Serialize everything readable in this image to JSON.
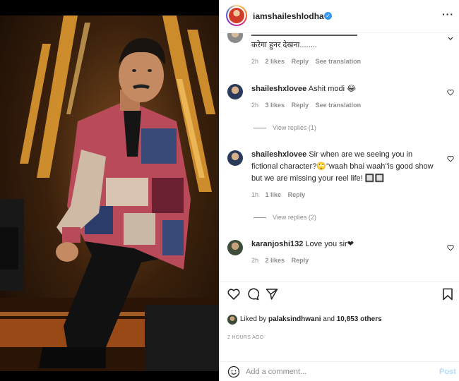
{
  "header": {
    "username": "iamshaileshlodha",
    "verified_icon": "verified-badge-icon",
    "more_icon": "more-options-icon"
  },
  "comments": [
    {
      "text": "करेगा हुनर देखना........",
      "time": "2h",
      "likes": "2 likes",
      "reply": "Reply",
      "translate": "See translation"
    },
    {
      "username": "shaileshxlovee",
      "text": "Ashit modi 😂",
      "time": "2h",
      "likes": "3 likes",
      "reply": "Reply",
      "translate": "See translation",
      "view_replies": "View replies (1)"
    },
    {
      "username": "shaileshxlovee",
      "text": "Sir when are we seeing you in fictional character?🙄\"waah bhai waah\"is good show but we are missing your reel life! 🔲🔲",
      "time": "1h",
      "likes": "1 like",
      "reply": "Reply",
      "view_replies": "View replies (2)"
    },
    {
      "username": "karanjoshi132",
      "text": "Love you sir❤",
      "time": "2h",
      "likes": "2 likes",
      "reply": "Reply"
    }
  ],
  "likes": {
    "prefix": "Liked by",
    "user": "palaksindhwani",
    "and": "and",
    "count": "10,853 others"
  },
  "time_ago": "2 HOURS AGO",
  "add_comment": {
    "placeholder": "Add a comment...",
    "post_label": "Post"
  },
  "colors": {
    "accent": "#3897f0",
    "post_disabled": "#b3dbff",
    "muted": "#8e8e8e"
  }
}
